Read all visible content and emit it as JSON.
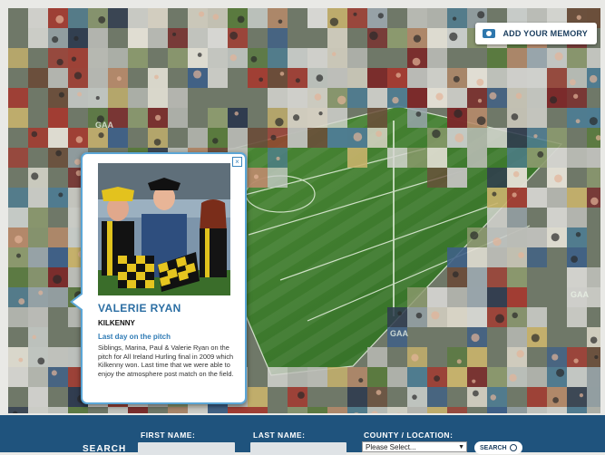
{
  "header": {
    "add_memory_label": "ADD YOUR MEMORY"
  },
  "memory": {
    "name": "VALERIE RYAN",
    "county": "KILKENNY",
    "title": "Last day on the pitch",
    "text": "Siblings, Marina, Paul & Valerie Ryan on the pitch for  All Ireland Hurling final in 2009 which Kilkenny won. Last time that we were able to enjoy the atmosphere post match on the field."
  },
  "search_bar": {
    "label": "SEARCH",
    "first_name_label": "FIRST NAME:",
    "last_name_label": "LAST NAME:",
    "county_label": "COUNTY / LOCATION:",
    "county_selected": "Please Select...",
    "search_button": "SEARCH",
    "first_name_value": "",
    "last_name_value": ""
  },
  "watermark": "GAA",
  "colors": {
    "accent": "#2b6ea3",
    "bar": "#1f537d",
    "pitch": "#3f7d2f"
  }
}
